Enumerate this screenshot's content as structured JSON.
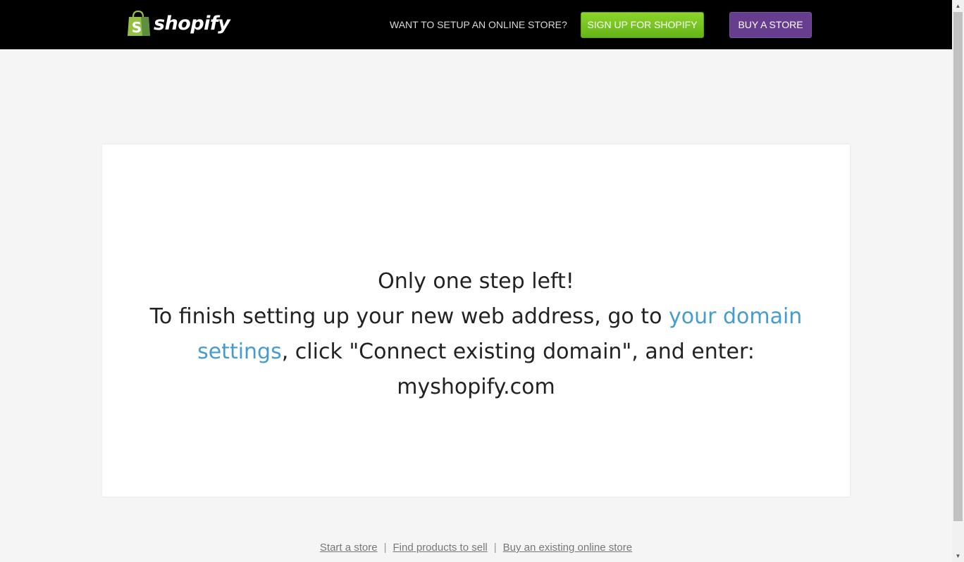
{
  "header": {
    "logo_text": "shopify",
    "logo_icon": "shopping-bag-icon",
    "prompt": "WANT TO SETUP AN ONLINE STORE?",
    "signup_label": "SIGN UP FOR SHOPIFY",
    "buy_label": "BUY A STORE"
  },
  "main": {
    "heading": "Only one step left!",
    "body_before": "To finish setting up your new web address, go to ",
    "link_text": "your domain settings",
    "body_after": ", click \"Connect existing domain\", and enter: myshopify.com"
  },
  "footer": {
    "links": [
      "Start a store",
      "Find products to sell",
      "Buy an existing online store"
    ],
    "separator": "|"
  },
  "scrollbar": {
    "up_icon": "▲",
    "down_icon": "▼"
  },
  "colors": {
    "topbar": "#000000",
    "signup_button": "#72c31f",
    "buy_button": "#673d8f",
    "link": "#479ccf",
    "background": "#f5f5f5"
  }
}
